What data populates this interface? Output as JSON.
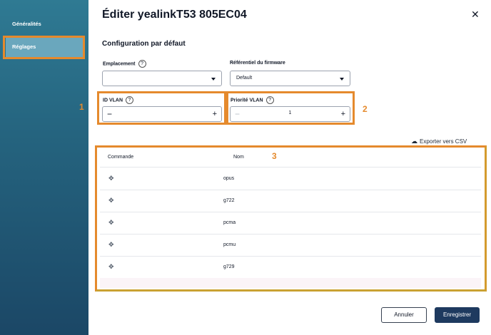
{
  "sidebar": {
    "items": [
      {
        "label": "Généralités"
      },
      {
        "label": "Réglages"
      }
    ]
  },
  "dialog": {
    "title": "Éditer yealinkT53 805EC04",
    "section_title": "Configuration par défaut",
    "location": {
      "label": "Emplacement",
      "value": ""
    },
    "firmware": {
      "label": "Référentiel du firmware",
      "value": "Default"
    },
    "vlan_id": {
      "label": "ID VLAN",
      "value": ""
    },
    "vlan_priority": {
      "label": "Priorité VLAN",
      "value": "1"
    },
    "export_label": "Exporter vers CSV",
    "table": {
      "headers": [
        "Commande",
        "Nom"
      ],
      "rows": [
        "opus",
        "g722",
        "pcma",
        "pcmu",
        "g729"
      ]
    },
    "buttons": {
      "cancel": "Annuler",
      "save": "Enregistrer"
    }
  },
  "annotations": [
    "1",
    "2",
    "3"
  ],
  "colors": {
    "sidebar": "#25647f",
    "highlight": "#e58a2d",
    "primary": "#1e3a5f"
  }
}
